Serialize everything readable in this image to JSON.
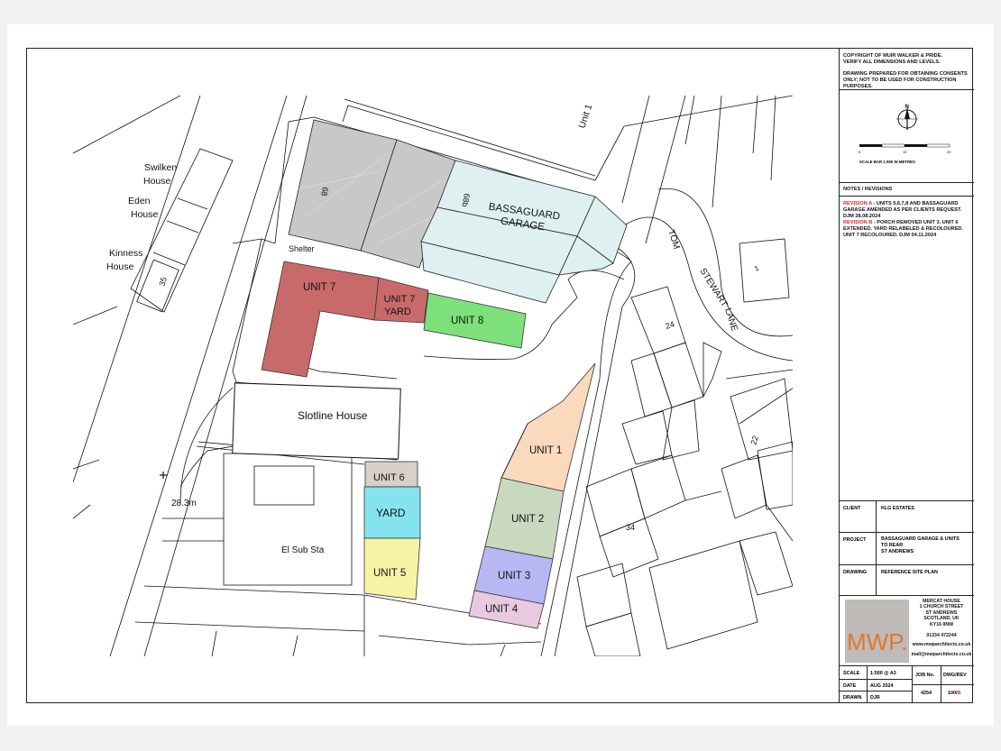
{
  "plan": {
    "labels": {
      "unit1_road": "Unit 1",
      "swilken": [
        "Swilken",
        "House"
      ],
      "eden": [
        "Eden",
        "House"
      ],
      "kinness": [
        "Kinness",
        "House"
      ],
      "shelter": "Shelter",
      "no35": "35",
      "no68": "68",
      "no68b": "68b",
      "bassaguard": [
        "BASSAGUARD",
        "GARAGE"
      ],
      "unit7": "UNIT 7",
      "unit7yard": [
        "UNIT 7",
        "YARD"
      ],
      "unit8": "UNIT 8",
      "tom": "TOM",
      "stewart_lane": [
        "STEWART",
        "LANE"
      ],
      "no24": "24",
      "no1": "1",
      "no22": "22",
      "no34": "34",
      "slotline": "Slotline House",
      "unit6": "UNIT 6",
      "yard": "YARD",
      "unit5": "UNIT 5",
      "el_sub": "El Sub Sta",
      "level": "28.3m",
      "unit1": "UNIT 1",
      "unit2": "UNIT 2",
      "unit3": "UNIT 3",
      "unit4": "UNIT 4"
    },
    "colors": {
      "grey": "#c8c8c8",
      "bassaguard": "#dff0f0",
      "unit7": "#c96a6a",
      "unit8": "#7ee07a",
      "unit1": "#fad9bc",
      "unit2": "#c8d9c0",
      "unit3": "#b7b7f3",
      "unit4": "#e9c9e0",
      "unit5": "#f6f3a5",
      "unit6": "#d8cfc6",
      "yard": "#85e3ef"
    }
  },
  "title_block": {
    "copyright": [
      "COPYRIGHT OF MUIR WALKER & PRIDE.",
      "VERIFY ALL DIMENSIONS AND LEVELS."
    ],
    "consent": [
      "DRAWING PREPARED FOR OBTAINING CONSENTS",
      "ONLY; NOT TO BE USED FOR CONSTRUCTION",
      "PURPOSES."
    ],
    "north": "N",
    "scale_ticks": [
      "0",
      "10",
      "20"
    ],
    "scale_caption": "SCALE BAR 1:500 IN METRES",
    "notes_heading": "NOTES / REVISIONS",
    "revision_a_label": "REVISION A",
    "revision_a_text": " - UNITS 5,6,7,8 AND BASSAGUARD GARAGE AMENDED AS PER CLIENTS REQUEST. DJM 28.08.2024",
    "revision_b_label": "REVISION B",
    "revision_b_text": " - PORCH REMOVED UNIT 3. UNIT 6 EXTENDED. YARD RELABELED & RECOLOURED. UNIT 7 RECOLOURED. DJM 04.11.2024",
    "client_label": "CLIENT",
    "client": "KLG ESTATES",
    "project_label": "PROJECT",
    "project": [
      "BASSAGUARD GARAGE & UNITS",
      "TO REAR",
      "ST ANDREWS"
    ],
    "drawing_label": "DRAWING",
    "drawing": "REFERENCE SITE PLAN",
    "logo": "MWP.",
    "address": [
      "MERCAT HOUSE",
      "1 CHURCH STREET",
      "ST ANDREWS",
      "SCOTLAND, UK",
      "KY16 9NW"
    ],
    "phone": "01334 472244",
    "web": "www.mwparchitects.co.uk",
    "email": "mail@mwparchitects.co.uk",
    "scale_label": "SCALE",
    "scale": "1:500 @ A3",
    "date_label": "DATE",
    "date": "AUG 2024",
    "drawn_label": "DRAWN",
    "drawn": "DJR",
    "job_label": "JOB No.",
    "job": "4254",
    "dwg_label": "DWG/REV",
    "dwg": "100/",
    "rev": "B"
  }
}
